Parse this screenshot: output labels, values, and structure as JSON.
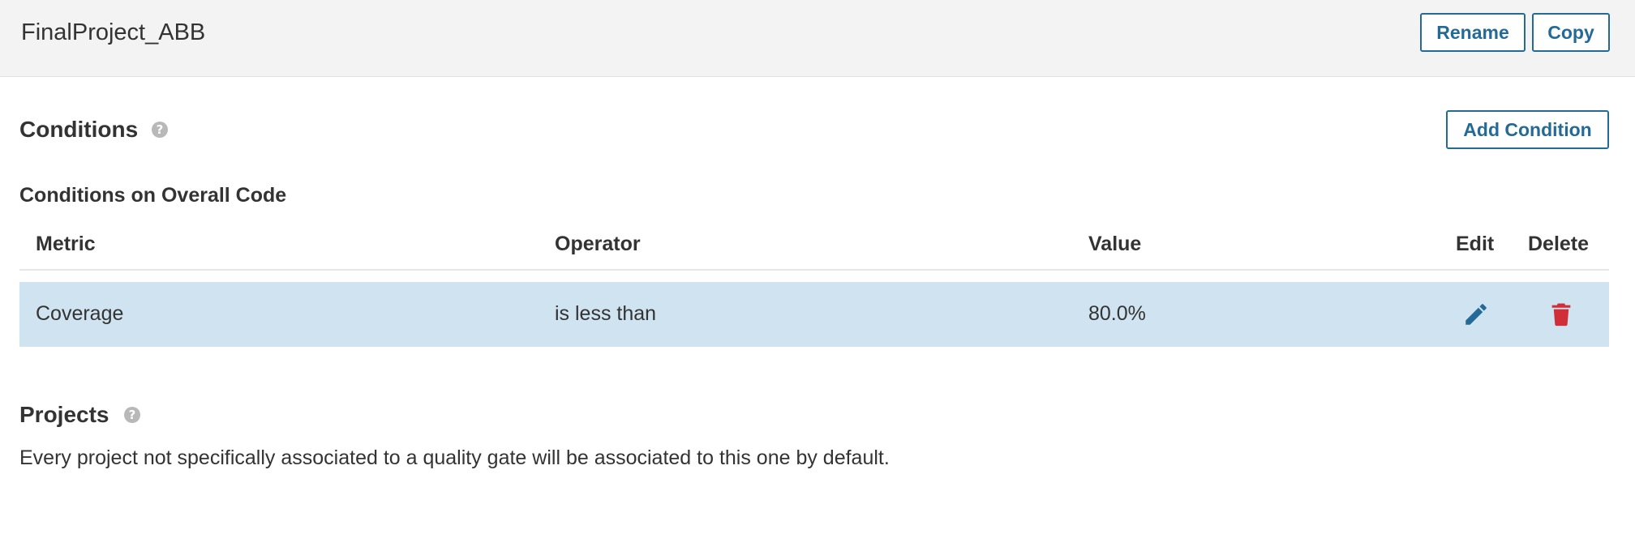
{
  "header": {
    "title": "FinalProject_ABB",
    "rename_label": "Rename",
    "copy_label": "Copy"
  },
  "conditions": {
    "title": "Conditions",
    "help_glyph": "?",
    "add_label": "Add Condition",
    "overall_title": "Conditions on Overall Code",
    "columns": {
      "metric": "Metric",
      "operator": "Operator",
      "value": "Value",
      "edit": "Edit",
      "delete": "Delete"
    },
    "rows": [
      {
        "metric": "Coverage",
        "operator": "is less than",
        "value": "80.0%",
        "edit_icon": "pencil-icon",
        "delete_icon": "trash-icon"
      }
    ]
  },
  "projects": {
    "title": "Projects",
    "help_glyph": "?",
    "description": "Every project not specifically associated to a quality gate will be associated to this one by default."
  },
  "colors": {
    "accent": "#236a97",
    "row_highlight": "#cfe3f0",
    "delete": "#d02f3a",
    "header_bg": "#f3f3f3"
  }
}
